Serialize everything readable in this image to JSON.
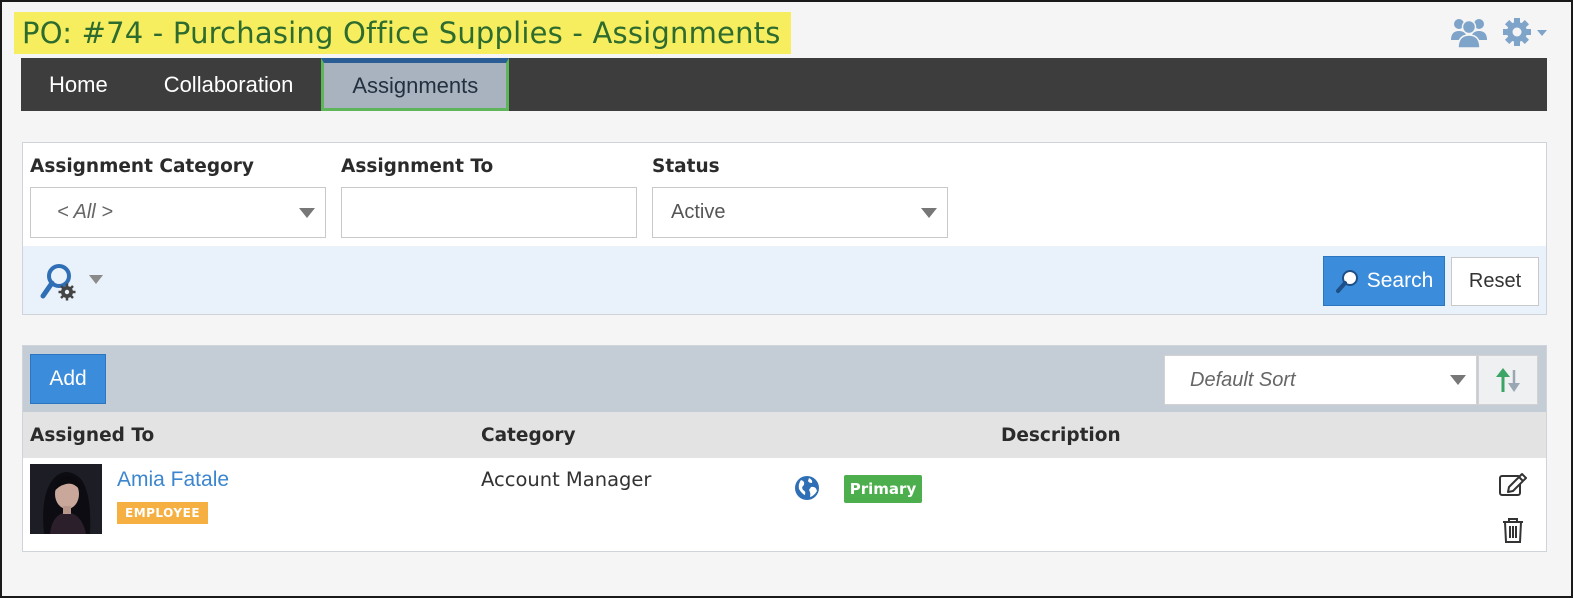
{
  "page": {
    "title": "PO: #74 - Purchasing Office Supplies - Assignments",
    "title_highlight_color": "#f6ee5e",
    "title_text_color": "#2e6b2e"
  },
  "top_icons": [
    "users-icon",
    "gear-icon"
  ],
  "nav": {
    "items": [
      {
        "label": "Home",
        "active": false
      },
      {
        "label": "Collaboration",
        "active": false
      },
      {
        "label": "Assignments",
        "active": true
      }
    ]
  },
  "filters": {
    "category": {
      "label": "Assignment Category",
      "value": "< All >"
    },
    "assigned_to": {
      "label": "Assignment To",
      "value": ""
    },
    "status": {
      "label": "Status",
      "value": "Active"
    },
    "search_label": "Search",
    "reset_label": "Reset"
  },
  "toolbar": {
    "add_label": "Add",
    "sort_value": "Default Sort"
  },
  "table": {
    "columns": [
      "Assigned To",
      "Category",
      "Description"
    ],
    "rows": [
      {
        "assigned_to": "Amia Fatale",
        "badge": "EMPLOYEE",
        "category": "Account Manager",
        "primary_label": "Primary",
        "description": ""
      }
    ]
  },
  "colors": {
    "accent_blue": "#3c8cdc",
    "nav_bg": "#3d3d3d",
    "primary_green": "#4cae4c",
    "employee_orange": "#f5b041"
  }
}
